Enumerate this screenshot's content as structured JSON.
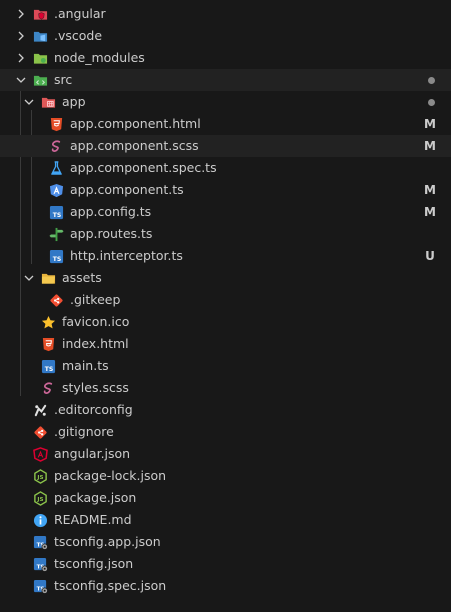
{
  "explorer": {
    "items": [
      {
        "label": ".angular",
        "badge": ""
      },
      {
        "label": ".vscode",
        "badge": ""
      },
      {
        "label": "node_modules",
        "badge": ""
      },
      {
        "label": "src",
        "badge": ""
      },
      {
        "label": "app",
        "badge": ""
      },
      {
        "label": "app.component.html",
        "badge": "M"
      },
      {
        "label": "app.component.scss",
        "badge": "M"
      },
      {
        "label": "app.component.spec.ts",
        "badge": ""
      },
      {
        "label": "app.component.ts",
        "badge": "M"
      },
      {
        "label": "app.config.ts",
        "badge": "M"
      },
      {
        "label": "app.routes.ts",
        "badge": ""
      },
      {
        "label": "http.interceptor.ts",
        "badge": "U"
      },
      {
        "label": "assets",
        "badge": ""
      },
      {
        "label": ".gitkeep",
        "badge": ""
      },
      {
        "label": "favicon.ico",
        "badge": ""
      },
      {
        "label": "index.html",
        "badge": ""
      },
      {
        "label": "main.ts",
        "badge": ""
      },
      {
        "label": "styles.scss",
        "badge": ""
      },
      {
        "label": ".editorconfig",
        "badge": ""
      },
      {
        "label": ".gitignore",
        "badge": ""
      },
      {
        "label": "angular.json",
        "badge": ""
      },
      {
        "label": "package-lock.json",
        "badge": ""
      },
      {
        "label": "package.json",
        "badge": ""
      },
      {
        "label": "README.md",
        "badge": ""
      },
      {
        "label": "tsconfig.app.json",
        "badge": ""
      },
      {
        "label": "tsconfig.json",
        "badge": ""
      },
      {
        "label": "tsconfig.spec.json",
        "badge": ""
      }
    ]
  },
  "colors": {
    "background": "#181818",
    "selected_row": "#222222",
    "text": "#cccccc",
    "html_icon": "#e44d26",
    "scss_icon": "#cd6799",
    "angular_icon": "#dd0031",
    "ts_icon": "#3178c6",
    "json_icon": "#8bc34a",
    "git_icon": "#f14e32",
    "folder_icon": "#e8b33c",
    "info_icon": "#42a5f5"
  },
  "icons": {
    "angular_folder": "angular-folder-icon",
    "vscode_folder": "vscode-folder-icon",
    "node_folder": "node-modules-folder-icon",
    "src_folder": "src-folder-icon",
    "app_folder": "app-folder-icon",
    "assets_folder": "assets-folder-icon"
  }
}
